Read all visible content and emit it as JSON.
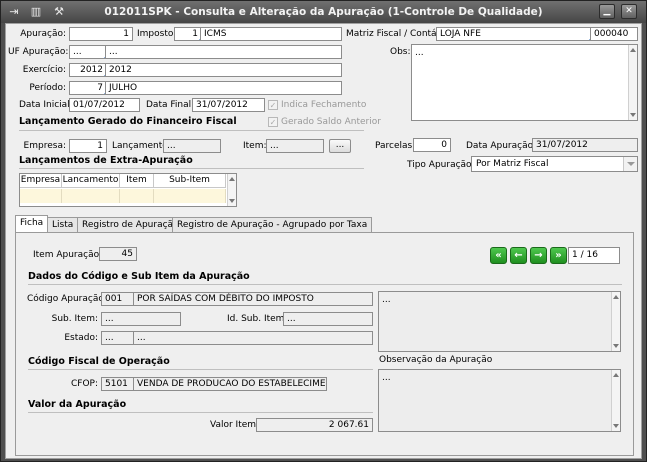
{
  "window": {
    "title": "012011SPK - Consulta e Alteração da Apuração (1-Controle De Qualidade)"
  },
  "header": {
    "apuracao_label": "Apuração:",
    "apuracao_value": "1",
    "imposto_label": "Imposto:",
    "imposto_code": "1",
    "imposto_name": "ICMS",
    "matriz_label": "Matriz Fiscal / Contábil:",
    "matriz_name": "LOJA NFE",
    "matriz_code": "000040",
    "uf_label": "UF Apuração:",
    "uf_code": "...",
    "uf_name": "...",
    "obs_label": "Obs:",
    "obs_value": "...",
    "exercicio_label": "Exercício:",
    "exercicio_code": "2012",
    "exercicio_name": "2012",
    "periodo_label": "Período:",
    "periodo_code": "7",
    "periodo_name": "JULHO",
    "data_inicial_label": "Data Inicial:",
    "data_inicial_value": "01/07/2012",
    "data_final_label": "Data Final:",
    "data_final_value": "31/07/2012",
    "indica_fechamento_label": "Indica Fechamento",
    "gerado_saldo_label": "Gerado Saldo Anterior"
  },
  "lancamento": {
    "section_title": "Lançamento Gerado do Financeiro Fiscal",
    "empresa_label": "Empresa:",
    "empresa_value": "1",
    "lancamento_label": "Lançamento:",
    "lancamento_value": "...",
    "item_label": "Item:",
    "item_value": "...",
    "ellipsis_button": "...",
    "parcelas_label": "Parcelas:",
    "parcelas_value": "0",
    "data_apuracao_label": "Data Apuração:",
    "data_apuracao_value": "31/07/2012",
    "tipo_apuracao_label": "Tipo Apuração:",
    "tipo_apuracao_value": "Por Matriz Fiscal"
  },
  "extra": {
    "section_title": "Lançamentos de Extra-Apuração",
    "columns": [
      "Empresa",
      "Lancamento",
      "Item",
      "Sub-Item"
    ]
  },
  "tabs": [
    {
      "label": "Ficha"
    },
    {
      "label": "Lista"
    },
    {
      "label": "Registro de Apuração"
    },
    {
      "label": "Registro de Apuração - Agrupado por Taxa"
    }
  ],
  "ficha": {
    "item_apuracao_label": "Item Apuração:",
    "item_apuracao_value": "45",
    "nav_counter": "1 / 16",
    "dados_title": "Dados do Código e Sub Item da Apuração",
    "codigo_label": "Código Apuração:",
    "codigo_code": "001",
    "codigo_name": "POR SAÍDAS COM DÉBITO DO IMPOSTO",
    "codigo_memo": "...",
    "subitem_label": "Sub. Item:",
    "subitem_value": "...",
    "id_subitem_label": "Id. Sub. Item:",
    "id_subitem_value": "...",
    "estado_label": "Estado:",
    "estado_code": "...",
    "estado_name": "...",
    "cfop_title": "Código Fiscal de Operação",
    "cfop_label": "CFOP:",
    "cfop_code": "5101",
    "cfop_name": "VENDA DE PRODUCAO DO ESTABELECIMENTO",
    "obs_apuracao_label": "Observação da Apuração",
    "obs_apuracao_value": "...",
    "valor_title": "Valor da Apuração",
    "valor_item_label": "Valor Item",
    "valor_item_value": "2 067.61"
  }
}
